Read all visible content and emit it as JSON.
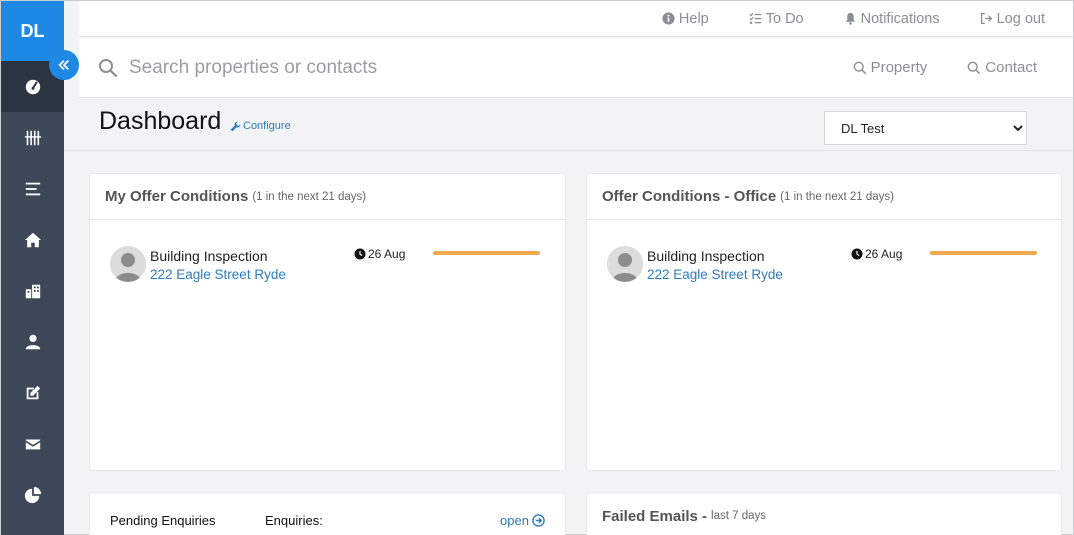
{
  "sidebar": {
    "brand": "DL",
    "items": [
      {
        "icon": "dashboard-icon"
      },
      {
        "icon": "tally-icon"
      },
      {
        "icon": "list-icon"
      },
      {
        "icon": "home-icon"
      },
      {
        "icon": "building-icon"
      },
      {
        "icon": "user-icon"
      },
      {
        "icon": "edit-icon"
      },
      {
        "icon": "envelope-icon"
      },
      {
        "icon": "pie-chart-icon"
      }
    ]
  },
  "topbar": {
    "help": "Help",
    "todo": "To Do",
    "notifications": "Notifications",
    "logout": "Log out"
  },
  "search": {
    "placeholder": "Search properties or contacts",
    "filter_property": "Property",
    "filter_contact": "Contact"
  },
  "header": {
    "title": "Dashboard",
    "configure": "Configure",
    "selected_office": "DL Test"
  },
  "cards": {
    "my_offer": {
      "title": "My Offer Conditions",
      "subtitle": "(1 in the next 21 days)",
      "items": [
        {
          "name": "Building Inspection",
          "address": "222 Eagle Street Ryde",
          "date": "26 Aug",
          "progress": 1.0
        }
      ]
    },
    "office_offer": {
      "title": "Offer Conditions - Office",
      "subtitle": "(1 in the next 21 days)",
      "items": [
        {
          "name": "Building Inspection",
          "address": "222 Eagle Street Ryde",
          "date": "26 Aug",
          "progress": 1.0
        }
      ]
    },
    "pending": {
      "label": "Pending Enquiries",
      "enquiries_label": "Enquiries:",
      "open": "open"
    },
    "failed_emails": {
      "title": "Failed Emails -",
      "subtitle": "last 7 days"
    }
  },
  "colors": {
    "sidebar": "#3c4858",
    "accent": "#1e88e5",
    "link": "#2f7bbf",
    "progress": "#f0a84e"
  }
}
